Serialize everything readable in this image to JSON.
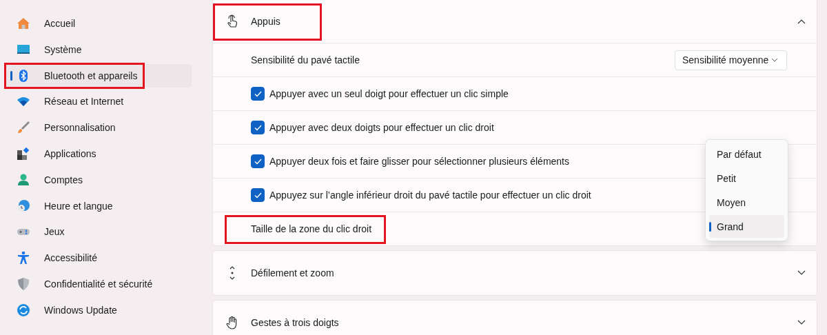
{
  "sidebar": {
    "items": [
      {
        "label": "Accueil",
        "selected": false,
        "highlighted": false
      },
      {
        "label": "Système",
        "selected": false,
        "highlighted": false
      },
      {
        "label": "Bluetooth et appareils",
        "selected": true,
        "highlighted": true
      },
      {
        "label": "Réseau et Internet",
        "selected": false,
        "highlighted": false
      },
      {
        "label": "Personnalisation",
        "selected": false,
        "highlighted": false
      },
      {
        "label": "Applications",
        "selected": false,
        "highlighted": false
      },
      {
        "label": "Comptes",
        "selected": false,
        "highlighted": false
      },
      {
        "label": "Heure et langue",
        "selected": false,
        "highlighted": false
      },
      {
        "label": "Jeux",
        "selected": false,
        "highlighted": false
      },
      {
        "label": "Accessibilité",
        "selected": false,
        "highlighted": false
      },
      {
        "label": "Confidentialité et sécurité",
        "selected": false,
        "highlighted": false
      },
      {
        "label": "Windows Update",
        "selected": false,
        "highlighted": false
      }
    ]
  },
  "sections": [
    {
      "title": "Appuis",
      "expanded": true,
      "highlighted": true,
      "rows": [
        {
          "kind": "select",
          "label": "Sensibilité du pavé tactile",
          "value": "Sensibilité moyenne",
          "highlighted": false
        },
        {
          "kind": "checkbox",
          "label": "Appuyer avec un seul doigt pour effectuer un clic simple",
          "checked": true,
          "highlighted": false
        },
        {
          "kind": "checkbox",
          "label": "Appuyer avec deux doigts pour effectuer un clic droit",
          "checked": true,
          "highlighted": false
        },
        {
          "kind": "checkbox",
          "label": "Appuyer deux fois et faire glisser pour sélectionner plusieurs éléments",
          "checked": true,
          "highlighted": false
        },
        {
          "kind": "checkbox",
          "label": "Appuyez sur l’angle inférieur droit du pavé tactile pour effectuer un clic droit",
          "checked": true,
          "highlighted": false
        },
        {
          "kind": "label",
          "label": "Taille de la zone du clic droit",
          "highlighted": true
        }
      ],
      "menu": {
        "options": [
          {
            "label": "Par défaut",
            "selected": false
          },
          {
            "label": "Petit",
            "selected": false
          },
          {
            "label": "Moyen",
            "selected": false
          },
          {
            "label": "Grand",
            "selected": true
          }
        ]
      }
    },
    {
      "title": "Défilement et zoom",
      "expanded": false,
      "highlighted": false
    },
    {
      "title": "Gestes à trois doigts",
      "expanded": false,
      "highlighted": false
    }
  ]
}
